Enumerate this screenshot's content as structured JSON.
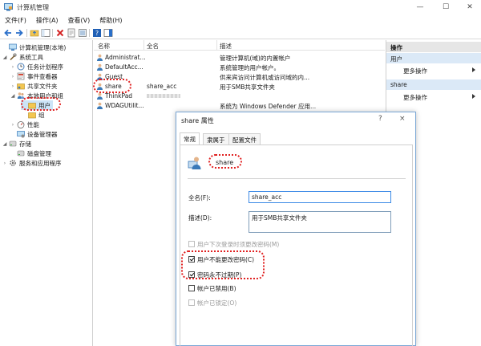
{
  "window": {
    "title": "计算机管理"
  },
  "menu": [
    "文件(F)",
    "操作(A)",
    "查看(V)",
    "帮助(H)"
  ],
  "tree": {
    "root": "计算机管理(本地)",
    "system_tools": "系统工具",
    "task_scheduler": "任务计划程序",
    "event_viewer": "事件查看器",
    "shared_folders": "共享文件夹",
    "local_users_groups": "本地用户和组",
    "users": "用户",
    "groups": "组",
    "performance": "性能",
    "device_manager": "设备管理器",
    "storage": "存储",
    "disk_management": "磁盘管理",
    "services_apps": "服务和应用程序"
  },
  "list": {
    "columns": [
      "名称",
      "全名",
      "描述"
    ],
    "rows": [
      {
        "name": "Administrat...",
        "full_name": "",
        "description": "管理计算机(域)的内置帐户"
      },
      {
        "name": "DefaultAcc...",
        "full_name": "",
        "description": "系统管理的用户帐户。"
      },
      {
        "name": "Guest",
        "full_name": "",
        "description": "供来宾访问计算机或访问域的内..."
      },
      {
        "name": "share",
        "full_name": "share_acc",
        "description": "用于SMB共享文件夹"
      },
      {
        "name": "ThinkPad",
        "full_name": "",
        "description": ""
      },
      {
        "name": "WDAGUtilit...",
        "full_name": "",
        "description": "系统为 Windows Defender 应用..."
      }
    ]
  },
  "actions": {
    "header": "操作",
    "section1": "用户",
    "more1": "更多操作",
    "section2": "share",
    "more2": "更多操作"
  },
  "dialog": {
    "title": "share 属性",
    "help": "?",
    "close": "×",
    "tabs": [
      "常规",
      "隶属于",
      "配置文件"
    ],
    "username": "share",
    "fullname_label": "全名(F):",
    "fullname_value": "share_acc",
    "desc_label": "描述(D):",
    "desc_value": "用于SMB共享文件夹",
    "options": [
      {
        "label": "用户下次登录时须更改密码(M)",
        "checked": false,
        "enabled": false
      },
      {
        "label": "用户不能更改密码(C)",
        "checked": true,
        "enabled": true
      },
      {
        "label": "密码永不过期(P)",
        "checked": true,
        "enabled": true
      },
      {
        "label": "帐户已禁用(B)",
        "checked": false,
        "enabled": true
      },
      {
        "label": "帐户已锁定(O)",
        "checked": false,
        "enabled": false
      }
    ]
  },
  "colors": {
    "accent": "#3c8ae6",
    "annotation": "#e02020",
    "selection": "#cce4f7"
  }
}
